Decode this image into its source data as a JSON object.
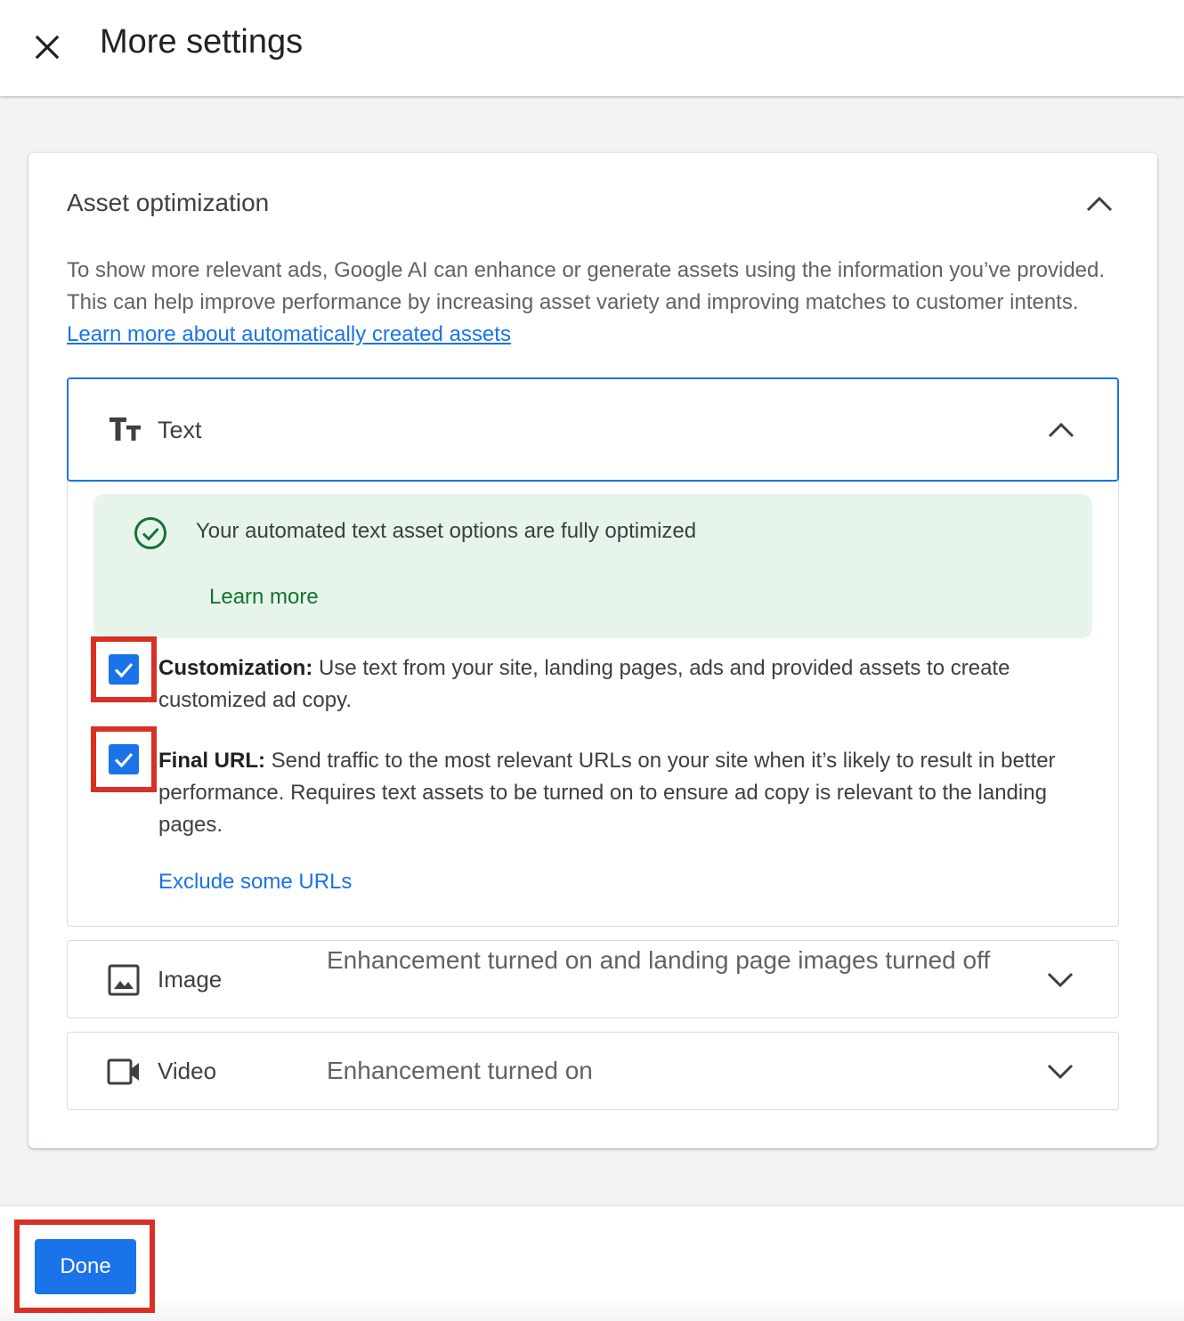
{
  "header": {
    "title": "More settings",
    "close_icon": "close-icon"
  },
  "card": {
    "title": "Asset optimization",
    "description": "To show more relevant ads, Google AI can enhance or generate assets using the information you’ve provided. This can help improve performance by increasing asset variety and improving matches to customer intents.",
    "description_link": "Learn more about automatically created assets",
    "text_section": {
      "label": "Text",
      "expanded": true,
      "banner": {
        "message": "Your automated text asset options are fully optimized",
        "link": "Learn more"
      },
      "options": [
        {
          "title": "Customization:",
          "text": "Use text from your site, landing pages, ads and provided assets to create customized ad copy.",
          "checked": true
        },
        {
          "title": "Final URL:",
          "text": "Send traffic to the most relevant URLs on your site when it’s likely to result in better performance. Requires text assets to be turned on to ensure ad copy is relevant to the landing pages.",
          "checked": true
        }
      ],
      "exclude_link": "Exclude some URLs"
    },
    "image_section": {
      "label": "Image",
      "status": "Enhancement turned on and landing page images turned off",
      "expanded": false
    },
    "video_section": {
      "label": "Video",
      "status": "Enhancement turned on",
      "expanded": false
    }
  },
  "footer": {
    "done_label": "Done"
  },
  "colors": {
    "accent": "#1a73e8",
    "success": "#137333",
    "success_bg": "#e6f4ea",
    "highlight": "#d93025"
  }
}
